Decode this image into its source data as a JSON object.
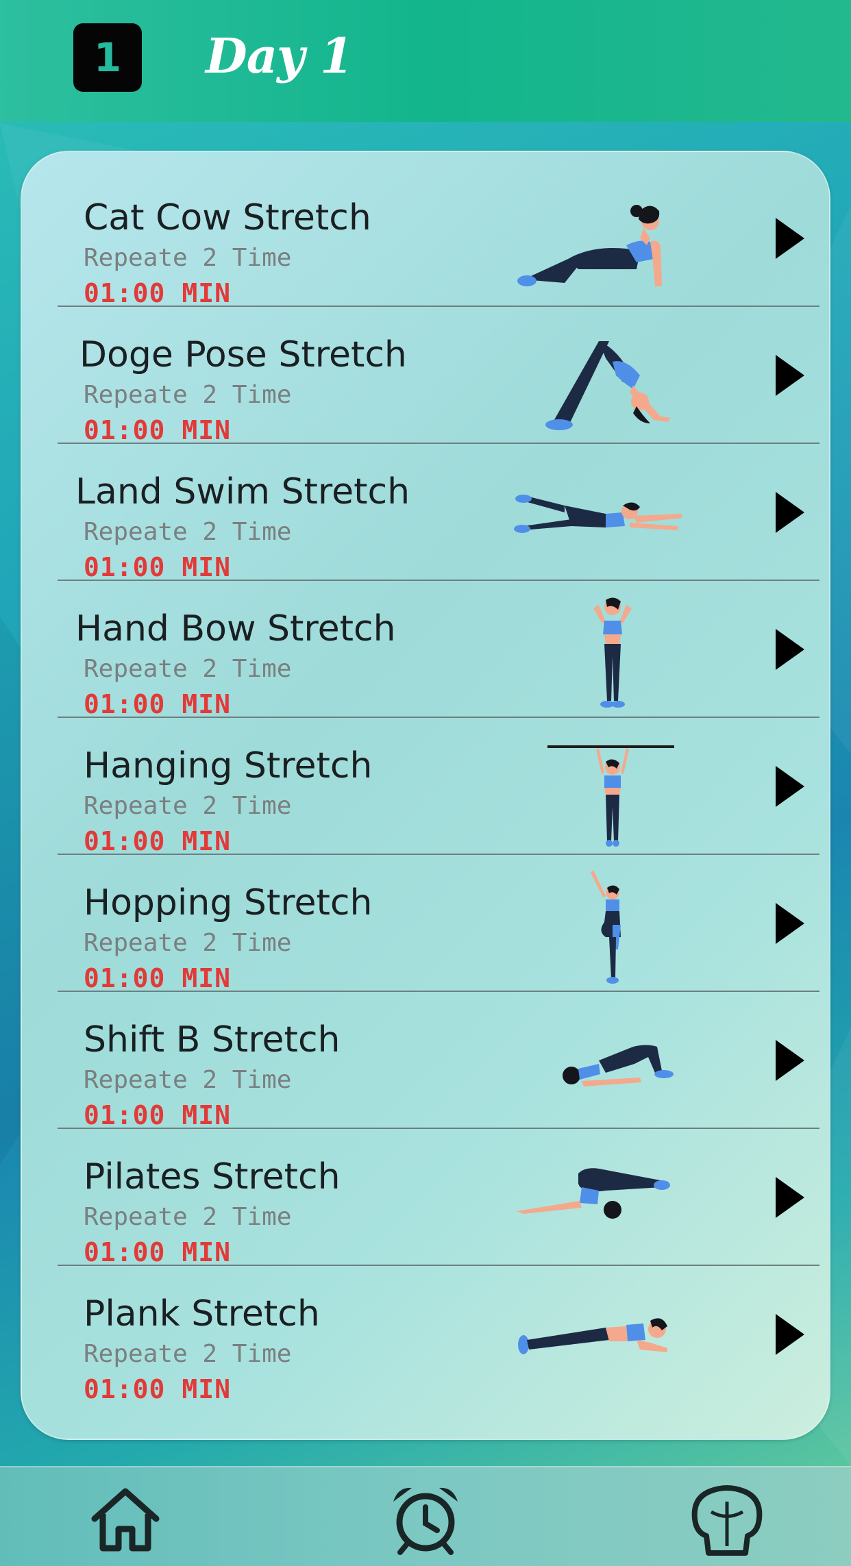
{
  "header": {
    "day_number": "1",
    "title": "Day 1"
  },
  "exercises": [
    {
      "title": "Cat Cow Stretch",
      "repeat": "Repeate 2 Time",
      "time": "01:00",
      "unit": "MIN",
      "figure": "cat-cow-figure"
    },
    {
      "title": "Doge Pose Stretch",
      "repeat": "Repeate 2 Time",
      "time": "01:00",
      "unit": "MIN",
      "figure": "downward-dog-figure"
    },
    {
      "title": "Land Swim Stretch",
      "repeat": "Repeate 2 Time",
      "time": "01:00",
      "unit": "MIN",
      "figure": "land-swim-figure"
    },
    {
      "title": "Hand Bow Stretch",
      "repeat": "Repeate 2 Time",
      "time": "01:00",
      "unit": "MIN",
      "figure": "standing-figure"
    },
    {
      "title": "Hanging Stretch",
      "repeat": "Repeate 2 Time",
      "time": "01:00",
      "unit": "MIN",
      "figure": "hanging-figure"
    },
    {
      "title": "Hopping Stretch",
      "repeat": "Repeate 2 Time",
      "time": "01:00",
      "unit": "MIN",
      "figure": "hopping-figure"
    },
    {
      "title": "Shift B Stretch",
      "repeat": "Repeate 2 Time",
      "time": "01:00",
      "unit": "MIN",
      "figure": "bridge-figure"
    },
    {
      "title": "Pilates Stretch",
      "repeat": "Repeate 2 Time",
      "time": "01:00",
      "unit": "MIN",
      "figure": "pilates-figure"
    },
    {
      "title": "Plank Stretch",
      "repeat": "Repeate 2 Time",
      "time": "01:00",
      "unit": "MIN",
      "figure": "plank-figure"
    }
  ],
  "bottom_nav": [
    {
      "icon": "home-icon"
    },
    {
      "icon": "alarm-clock-icon"
    },
    {
      "icon": "muscle-body-icon"
    }
  ],
  "colors": {
    "header_green": "#13b58d",
    "time_red": "#e23a38",
    "repeat_gray": "#7b7f80",
    "figure_navy": "#1d2a44",
    "figure_blue": "#4f8fe8",
    "skin": "#f4a98c"
  }
}
